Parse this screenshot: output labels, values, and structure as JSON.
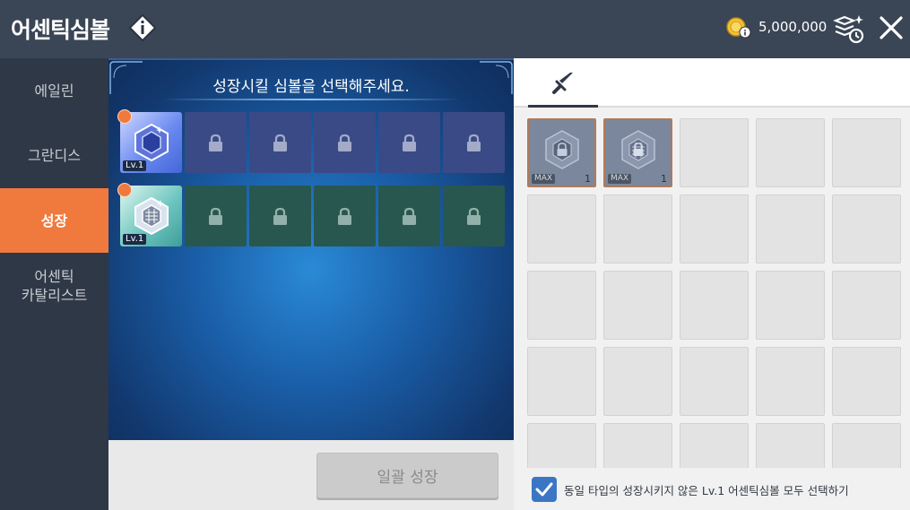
{
  "header": {
    "title": "어센틱심볼",
    "currency_amount": "5,000,000"
  },
  "sidebar": {
    "items": [
      {
        "label": "에일린",
        "active": false
      },
      {
        "label": "그란디스",
        "active": false
      },
      {
        "label": "성장",
        "active": true
      },
      {
        "label": "어센틱\n카탈리스트",
        "active": false
      }
    ]
  },
  "growth_panel": {
    "title": "성장시킬 심볼을 선택해주세요.",
    "rows": [
      {
        "symbol_level": "Lv.1",
        "theme": "blue",
        "locked_slots": 5
      },
      {
        "symbol_level": "Lv.1",
        "theme": "green",
        "locked_slots": 5
      }
    ],
    "bulk_button_label": "일괄 성장"
  },
  "inventory": {
    "tab_icon": "sword-icon",
    "items": [
      {
        "badge": "MAX",
        "quantity": "1"
      },
      {
        "badge": "MAX",
        "quantity": "1"
      }
    ],
    "checkbox_checked": true,
    "checkbox_label": "동일 타입의 성장시키지 않은 Lv.1 어센틱심볼 모두 선택하기"
  },
  "colors": {
    "active_tab": "#f07a3e",
    "header_bg": "#3a4555",
    "checkbox": "#3b76c4"
  }
}
